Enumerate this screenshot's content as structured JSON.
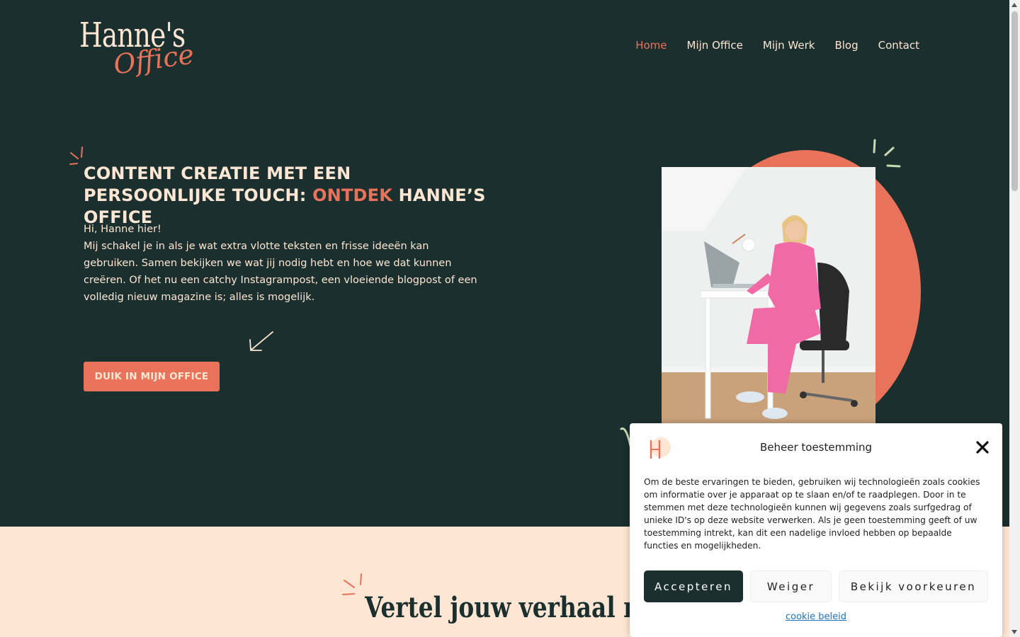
{
  "logo": {
    "line1": "Hanne's",
    "line2": "Office"
  },
  "nav": {
    "items": [
      {
        "label": "Home",
        "active": true
      },
      {
        "label": "Mijn Office",
        "active": false
      },
      {
        "label": "Mijn Werk",
        "active": false
      },
      {
        "label": "Blog",
        "active": false
      },
      {
        "label": "Contact",
        "active": false
      }
    ]
  },
  "hero": {
    "title_part1": "CONTENT CREATIE MET EEN PERSOONLIJKE TOUCH: ",
    "title_accent": "ONTDEK",
    "title_part2": " HANNE’S OFFICE",
    "greeting": "Hi, Hanne hier!",
    "body": "Mij schakel je in als je wat extra vlotte teksten en frisse ideeën kan gebruiken. Samen bekijken we wat jij nodig hebt en hoe we dat kunnen creëren. Of het nu een catchy Instagrampost, een vloeiende blogpost of een volledig nieuw magazine is; alles is mogelijk.",
    "cta_label": "DUIK IN MIJN OFFICE"
  },
  "lower": {
    "title": "Vertel jouw verhaal me"
  },
  "consent": {
    "title": "Beheer toestemming",
    "text": "Om de beste ervaringen te bieden, gebruiken wij technologieën zoals cookies om informatie over je apparaat op te slaan en/of te raadplegen. Door in te stemmen met deze technologieën kunnen wij gegevens zoals surfgedrag of unieke ID's op deze website verwerken. Als je geen toestemming geeft of uw toestemming intrekt, kan dit een nadelige invloed hebben op bepaalde functies en mogelijkheden.",
    "accept_label": "Accepteren",
    "deny_label": "Weiger",
    "prefs_label": "Bekijk voorkeuren",
    "policy_link": "cookie beleid"
  },
  "colors": {
    "dark_green": "#1b2f2e",
    "coral": "#e8735a",
    "cream": "#fde6d3"
  }
}
